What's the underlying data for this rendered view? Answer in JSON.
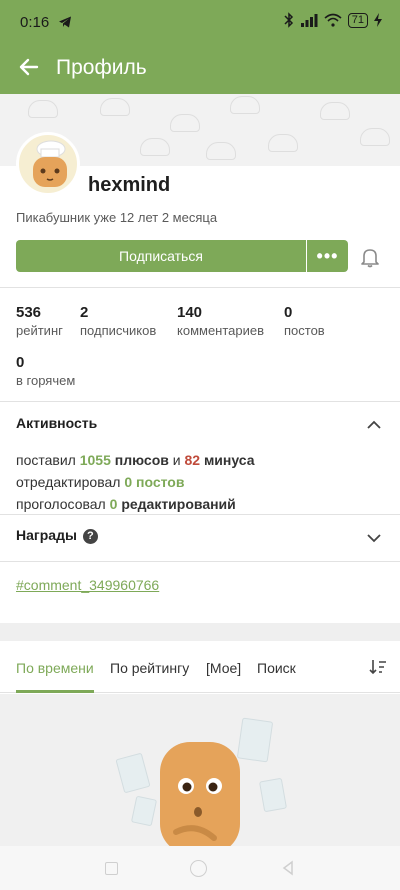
{
  "status_bar": {
    "time": "0:16",
    "battery": "71"
  },
  "app_bar": {
    "title": "Профиль"
  },
  "profile": {
    "username": "hexmind",
    "member_since": "Пикабушник уже 12 лет 2 месяца",
    "subscribe_label": "Подписаться",
    "more_label": "•••"
  },
  "stats": [
    {
      "value": "536",
      "label": "рейтинг"
    },
    {
      "value": "2",
      "label": "подписчиков"
    },
    {
      "value": "140",
      "label": "комментариев"
    },
    {
      "value": "0",
      "label": "постов"
    },
    {
      "value": "0",
      "label": "в горячем"
    }
  ],
  "activity": {
    "title": "Активность",
    "line1": {
      "prefix": "поставил",
      "plus_count": "1055",
      "plus_word": "плюсов",
      "and": "и",
      "minus_count": "82",
      "minus_word": "минуса"
    },
    "line2": {
      "prefix": "отредактировал",
      "count": "0 постов"
    },
    "line3": {
      "prefix": "проголосовал",
      "count": "0",
      "suffix": "редактирований"
    }
  },
  "awards": {
    "title": "Награды",
    "help": "?"
  },
  "comment_link": "#comment_349960766",
  "tabs": [
    {
      "label": "По времени",
      "active": true
    },
    {
      "label": "По рейтингу",
      "active": false
    },
    {
      "label": "[Мое]",
      "active": false
    },
    {
      "label": "Поиск",
      "active": false
    }
  ],
  "colors": {
    "brand_green": "#7ea958",
    "minus_red": "#c04b3b"
  },
  "icons": [
    "back-arrow-icon",
    "telegram-icon",
    "bluetooth-icon",
    "signal-icon",
    "wifi-icon",
    "battery-icon",
    "more-dots-icon",
    "bell-icon",
    "chevron-up-icon",
    "chevron-down-icon",
    "help-icon",
    "sort-icon"
  ]
}
